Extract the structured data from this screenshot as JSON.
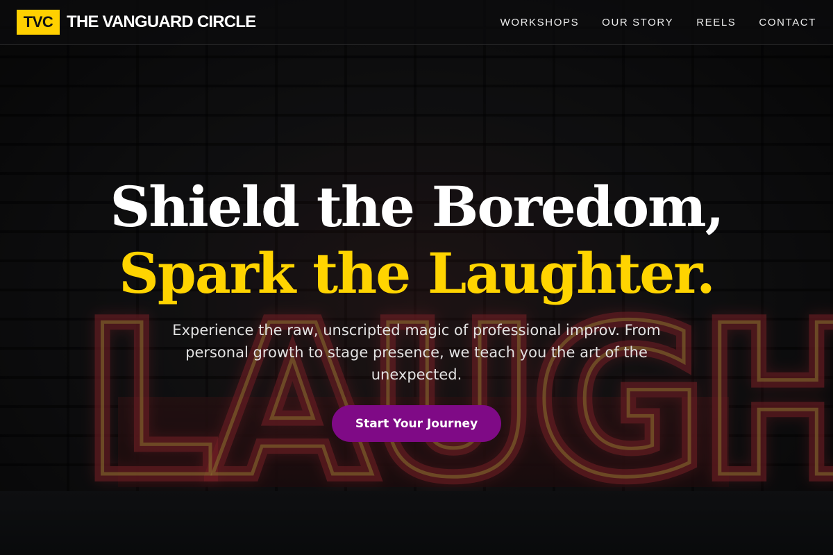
{
  "brand": {
    "logo_text": "TVC",
    "name": "THE VANGUARD CIRCLE",
    "accent_color": "#ffd000"
  },
  "nav": {
    "items": [
      {
        "label": "WORKSHOPS"
      },
      {
        "label": "OUR STORY"
      },
      {
        "label": "REELS"
      },
      {
        "label": "CONTACT"
      }
    ]
  },
  "hero": {
    "headline_line1": "Shield the Boredom,",
    "headline_line2": "Spark the Laughter.",
    "subtext": "Experience the raw, unscripted magic of professional improv. From personal growth to stage presence, we teach you the art of the unexpected.",
    "cta_label": "Start Your Journey",
    "cta_color": "#7f0a86",
    "highlight_color": "#ffd400"
  },
  "background": {
    "sign_text": "LAUGH",
    "description_icon": "neon-sign-image"
  }
}
